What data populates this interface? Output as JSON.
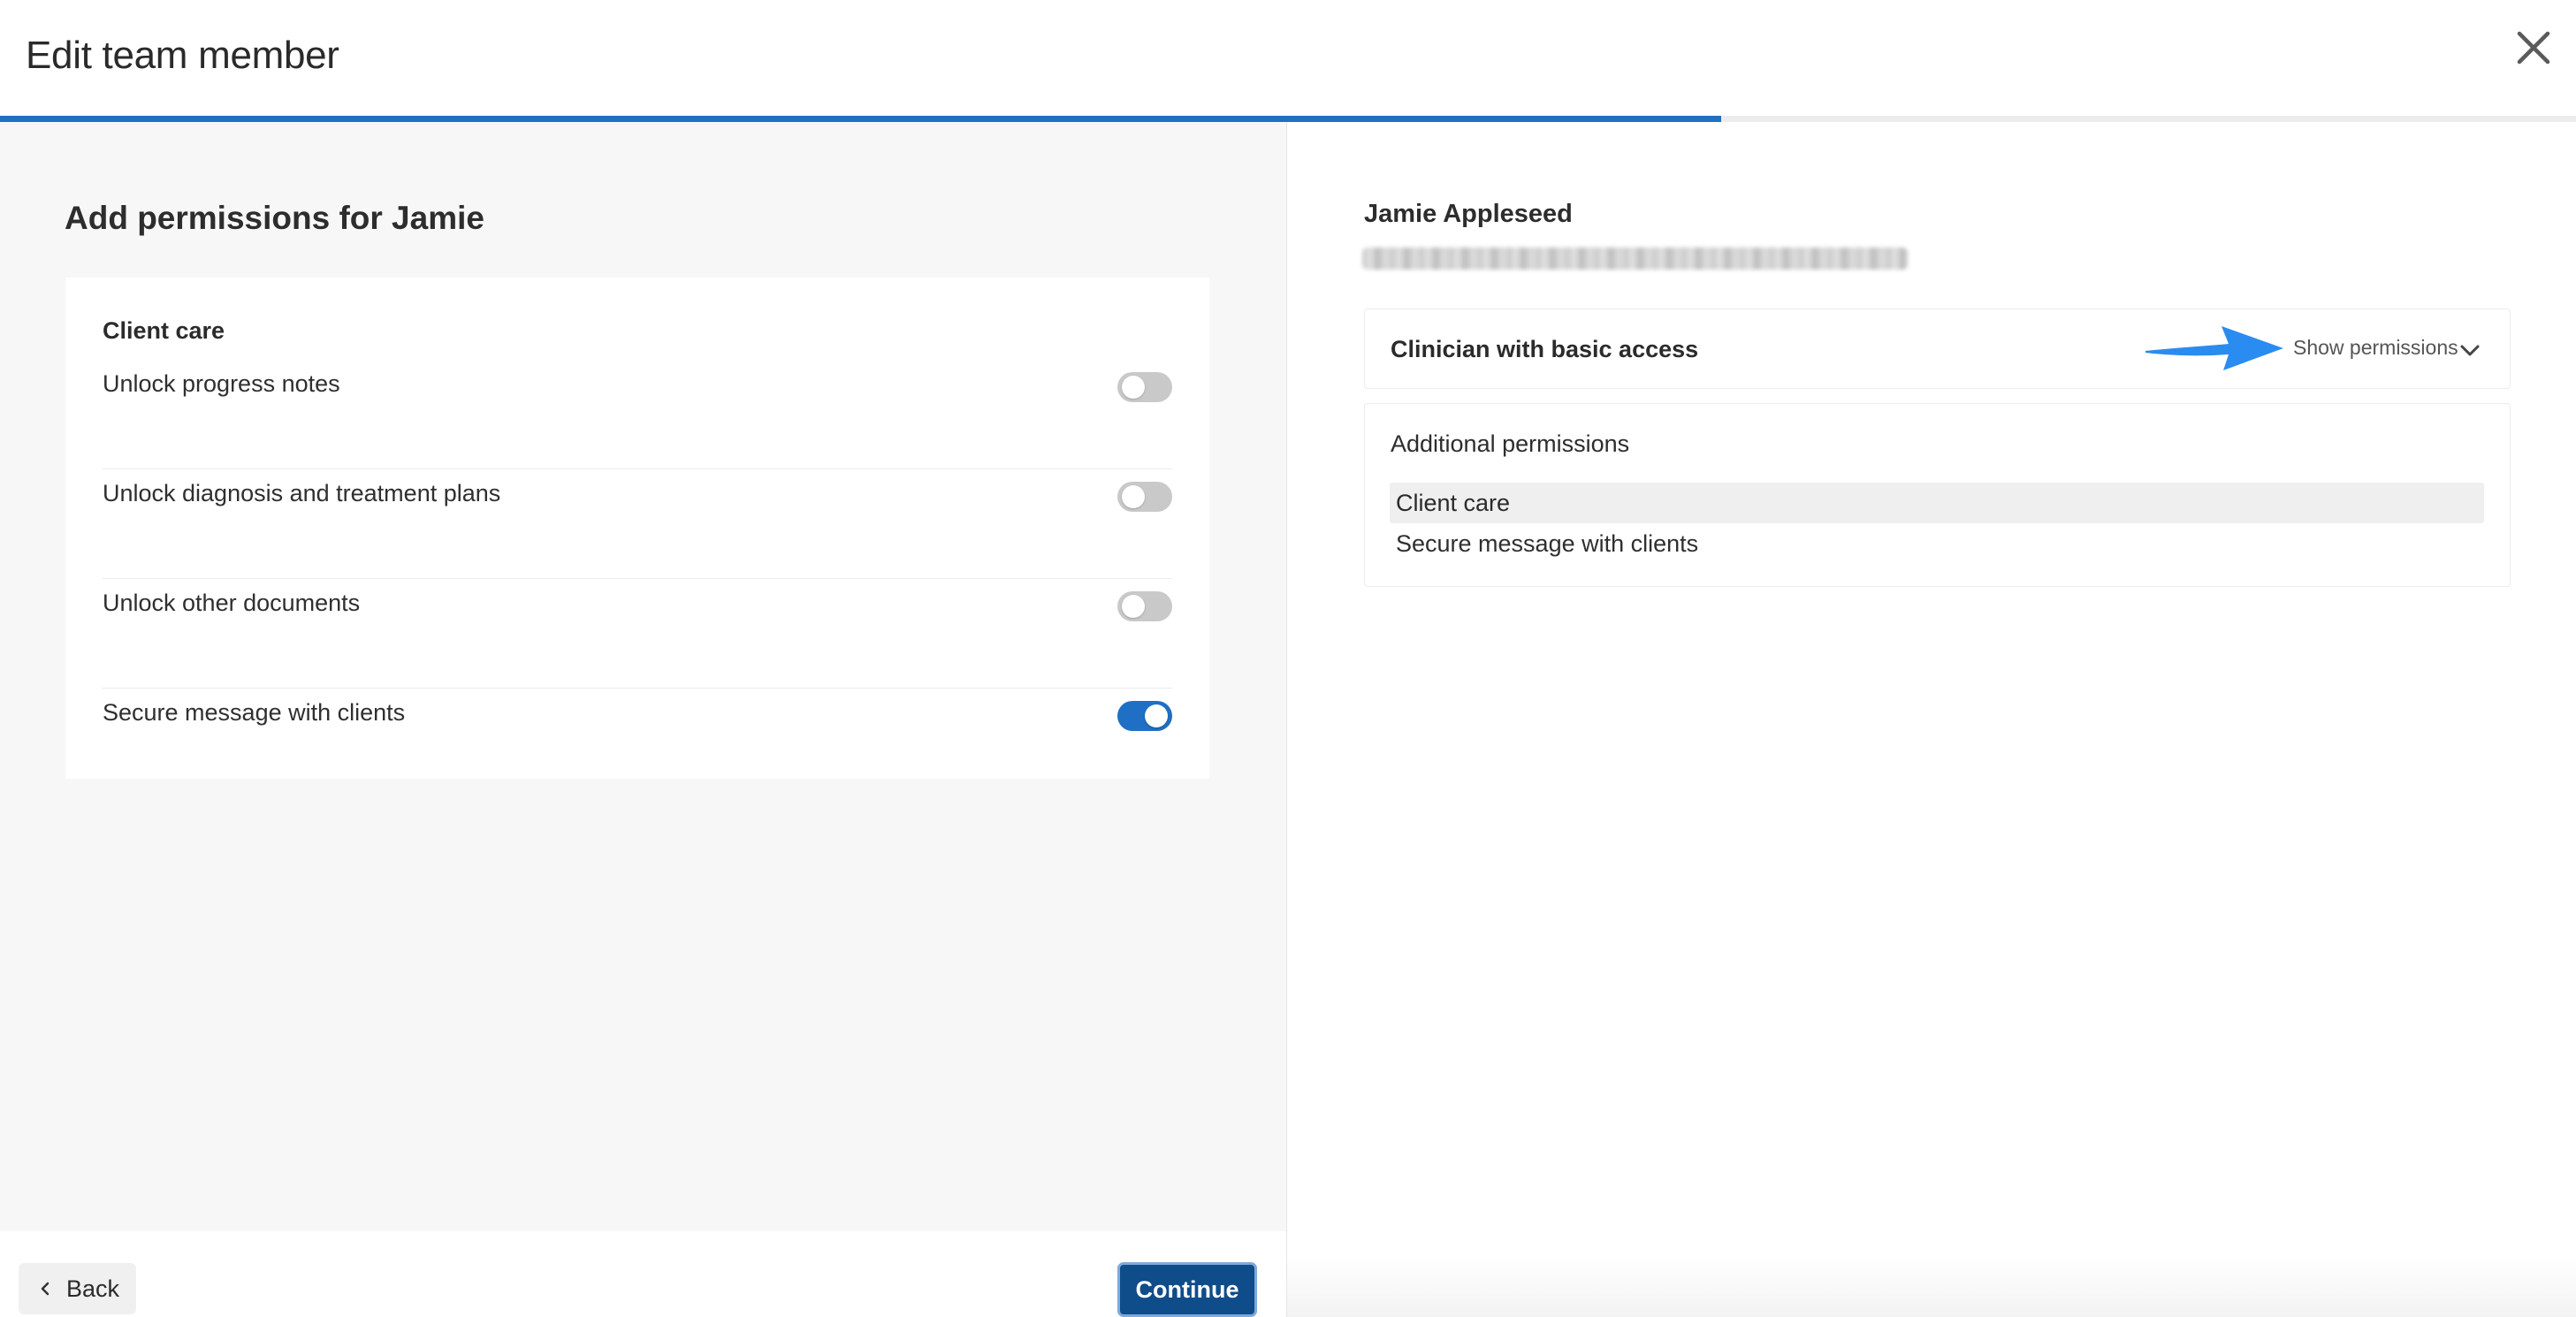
{
  "modal": {
    "title": "Edit team member",
    "progress_percent": 66.8
  },
  "left": {
    "heading": "Add permissions for Jamie",
    "section_title": "Client care",
    "permissions": [
      {
        "label": "Unlock progress notes",
        "enabled": false
      },
      {
        "label": "Unlock diagnosis and treatment plans",
        "enabled": false
      },
      {
        "label": "Unlock other documents",
        "enabled": false
      },
      {
        "label": "Secure message with clients",
        "enabled": true
      }
    ]
  },
  "footer": {
    "back_label": "Back",
    "continue_label": "Continue"
  },
  "right": {
    "member_name": "Jamie Appleseed",
    "role": {
      "label": "Clinician with basic access",
      "show_permissions_label": "Show permissions"
    },
    "additional": {
      "title": "Additional permissions",
      "group": "Client care",
      "items": [
        "Secure message with clients"
      ]
    }
  },
  "colors": {
    "accent": "#1f6fc5",
    "primary_button": "#0f4c8a",
    "annotation_arrow": "#2a8cf0"
  },
  "icons": {
    "close": "close-icon",
    "back": "chevron-left-icon",
    "expand": "chevron-down-icon",
    "annotation": "arrow-annotation-icon"
  }
}
